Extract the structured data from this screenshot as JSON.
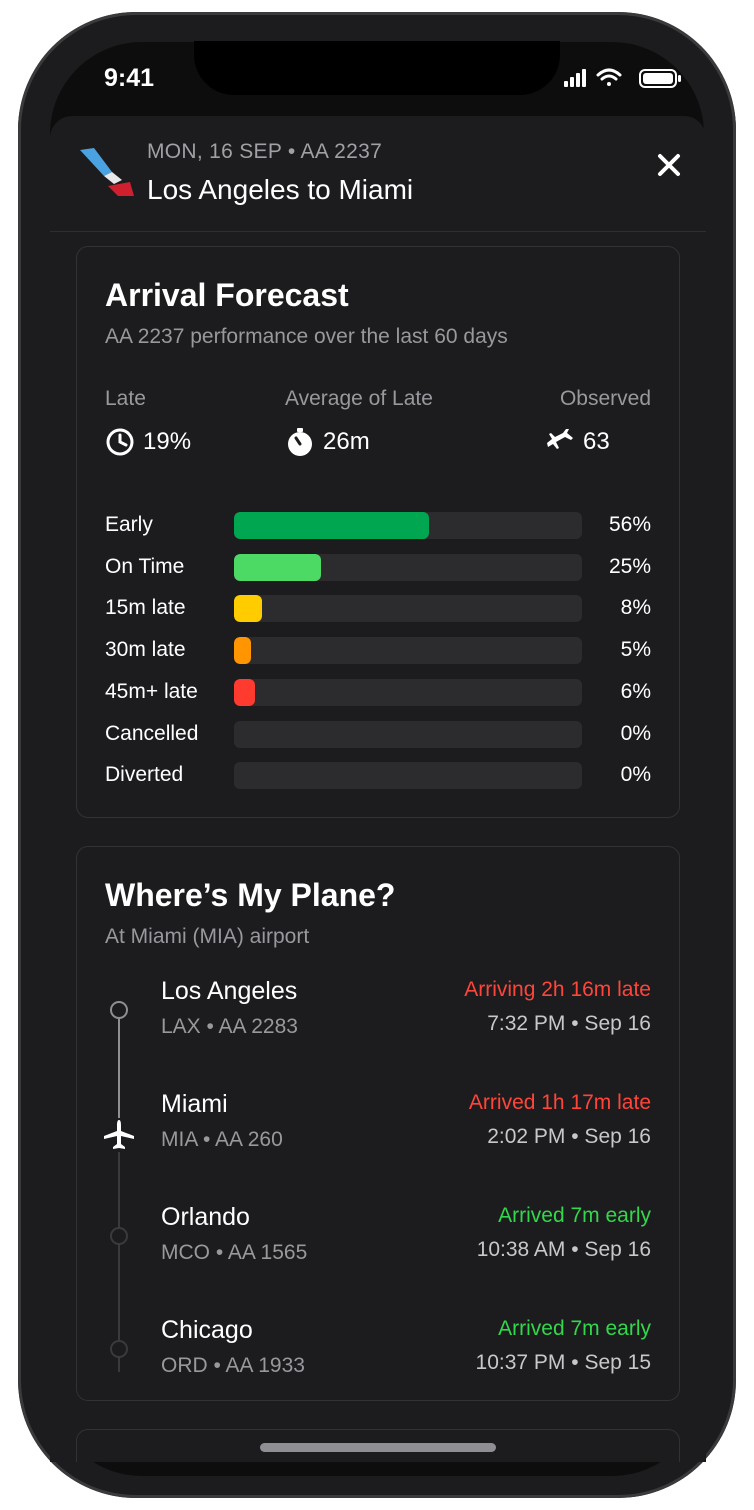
{
  "status_bar": {
    "time": "9:41"
  },
  "header": {
    "subtitle": "MON, 16 SEP • AA 2237",
    "title": "Los Angeles to Miami"
  },
  "forecast": {
    "title": "Arrival Forecast",
    "subtitle": "AA 2237 performance over the last 60 days",
    "stats": [
      {
        "label": "Late",
        "value": "19%",
        "icon": "clock-icon"
      },
      {
        "label": "Average of Late",
        "value": "26m",
        "icon": "stopwatch-icon"
      },
      {
        "label": "Observed",
        "value": "63",
        "icon": "plane-landing-icon"
      }
    ],
    "rows": [
      {
        "label": "Early",
        "pct": "56%",
        "value": 0.56,
        "color": "#00a650"
      },
      {
        "label": "On Time",
        "pct": "25%",
        "value": 0.25,
        "color": "#4cd964"
      },
      {
        "label": "15m late",
        "pct": "8%",
        "value": 0.08,
        "color": "#ffcc00"
      },
      {
        "label": "30m late",
        "pct": "5%",
        "value": 0.05,
        "color": "#ff9500"
      },
      {
        "label": "45m+ late",
        "pct": "6%",
        "value": 0.06,
        "color": "#ff3b30"
      },
      {
        "label": "Cancelled",
        "pct": "0%",
        "value": 0,
        "color": "#2c2c2e"
      },
      {
        "label": "Diverted",
        "pct": "0%",
        "value": 0,
        "color": "#2c2c2e"
      }
    ]
  },
  "plane": {
    "title": "Where’s My Plane?",
    "subtitle": "At Miami (MIA) airport",
    "stops": [
      {
        "city": "Los Angeles",
        "code": "LAX • AA 2283",
        "status": "Arriving 2h 16m late",
        "status_color": "#ff453a",
        "time": "7:32 PM • Sep 16"
      },
      {
        "city": "Miami",
        "code": "MIA • AA 260",
        "status": "Arrived 1h 17m late",
        "status_color": "#ff453a",
        "time": "2:02 PM • Sep 16"
      },
      {
        "city": "Orlando",
        "code": "MCO • AA 1565",
        "status": "Arrived 7m early",
        "status_color": "#32d74b",
        "time": "10:38 AM • Sep 16"
      },
      {
        "city": "Chicago",
        "code": "ORD • AA 1933",
        "status": "Arrived 7m early",
        "status_color": "#32d74b",
        "time": "10:37 PM • Sep 15"
      }
    ]
  }
}
